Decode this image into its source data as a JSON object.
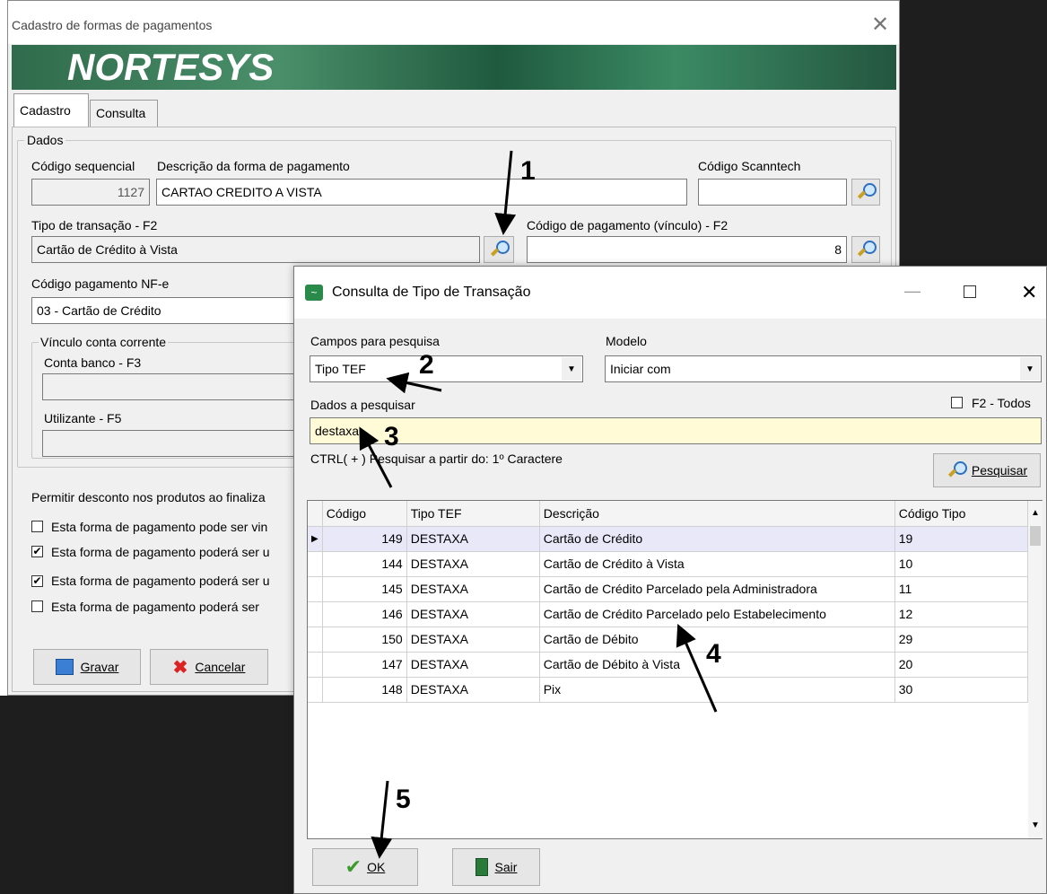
{
  "main": {
    "title": "Cadastro de formas de pagamentos",
    "brand": "NORTESYS",
    "tabs": [
      {
        "label": "Cadastro"
      },
      {
        "label": "Consulta"
      }
    ],
    "group_dados": "Dados",
    "seq_label": "Código sequencial",
    "seq_value": "1127",
    "desc_label": "Descrição da forma de pagamento",
    "desc_value": "CARTAO CREDITO A VISTA",
    "scanntech_label": "Código Scanntech",
    "scanntech_value": "",
    "tipo_label": "Tipo de transação - F2",
    "tipo_value": "Cartão de Crédito à Vista",
    "codpag_label": "Código de pagamento (vínculo) - F2",
    "codpag_value": "8",
    "nfe_label": "Código pagamento NF-e",
    "nfe_value": "03 - Cartão de Crédito",
    "vinculo_label": "Vínculo conta corrente",
    "conta_label": "Conta banco - F3",
    "utilizante_label": "Utilizante - F5",
    "permitir_label": "Permitir desconto nos produtos ao finaliza",
    "checks": [
      {
        "label": "Esta forma de pagamento pode ser vin",
        "checked": false
      },
      {
        "label": "Esta forma de pagamento poderá ser u",
        "checked": true
      },
      {
        "label": "Esta forma de pagamento poderá ser u",
        "checked": true
      },
      {
        "label": "Esta forma de pagamento poderá ser",
        "checked": false
      }
    ],
    "gravar": "Gravar",
    "cancelar": "Cancelar"
  },
  "dialog": {
    "title": "Consulta de Tipo de Transação",
    "campos_label": "Campos para pesquisa",
    "campos_value": "Tipo TEF",
    "modelo_label": "Modelo",
    "modelo_value": "Iniciar com",
    "dados_label": "Dados a pesquisar",
    "dados_value": "destaxa",
    "f2_label": "F2 - Todos",
    "ctrl_hint": "CTRL( + ) Pesquisar a partir do: 1º Caractere",
    "pesquisar": "Pesquisar",
    "columns": [
      "Código",
      "Tipo TEF",
      "Descrição",
      "Código Tipo"
    ],
    "rows": [
      [
        "149",
        "DESTAXA",
        "Cartão de Crédito",
        "19"
      ],
      [
        "144",
        "DESTAXA",
        "Cartão de Crédito à Vista",
        "10"
      ],
      [
        "145",
        "DESTAXA",
        "Cartão de Crédito Parcelado pela Administradora",
        "11"
      ],
      [
        "146",
        "DESTAXA",
        "Cartão de Crédito Parcelado pelo Estabelecimento",
        "12"
      ],
      [
        "150",
        "DESTAXA",
        "Cartão de Débito",
        "29"
      ],
      [
        "147",
        "DESTAXA",
        "Cartão de Débito à Vista",
        "20"
      ],
      [
        "148",
        "DESTAXA",
        "Pix",
        "30"
      ]
    ],
    "ok": "OK",
    "sair": "Sair"
  },
  "annotations": [
    "1",
    "2",
    "3",
    "4",
    "5"
  ]
}
